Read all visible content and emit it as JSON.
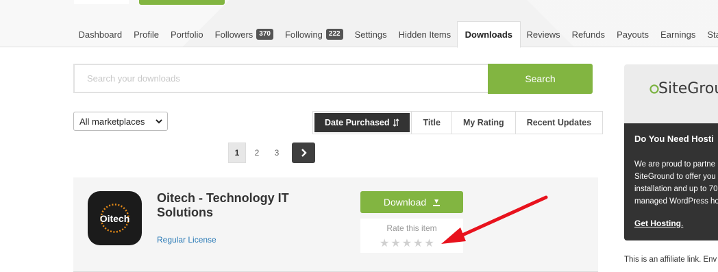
{
  "nav": {
    "tabs": [
      {
        "label": "Dashboard"
      },
      {
        "label": "Profile"
      },
      {
        "label": "Portfolio"
      },
      {
        "label": "Followers",
        "count": "370"
      },
      {
        "label": "Following",
        "count": "222"
      },
      {
        "label": "Settings"
      },
      {
        "label": "Hidden Items"
      },
      {
        "label": "Downloads",
        "active": true
      },
      {
        "label": "Reviews"
      },
      {
        "label": "Refunds"
      },
      {
        "label": "Payouts"
      },
      {
        "label": "Earnings"
      },
      {
        "label": "Statements"
      }
    ]
  },
  "search": {
    "placeholder": "Search your downloads",
    "value": "",
    "button_label": "Search"
  },
  "filters": {
    "marketplace_selected": "All marketplaces",
    "sort_options": [
      "Date Purchased",
      "Title",
      "My Rating",
      "Recent Updates"
    ],
    "active_sort": "Date Purchased",
    "sort_icon": "sort-arrows-icon"
  },
  "pagination": {
    "pages": [
      "1",
      "2",
      "3"
    ],
    "current": "1",
    "next_icon": "chevron-right-icon"
  },
  "item": {
    "logo_text": "Oitech",
    "title": "Oitech - Technology IT Solutions",
    "license": "Regular License",
    "download_label": "Download",
    "download_icon": "caret-down-icon",
    "rate_label": "Rate this item",
    "rating": 0,
    "max_rating": 5
  },
  "sidebar_ad": {
    "brand": "SiteGrou",
    "heading": "Do You Need Hosti",
    "lines": [
      "We are proud to partne",
      "SiteGround to offer you",
      "installation and up to 70",
      "managed WordPress ho"
    ],
    "link": "Get Hosting",
    "link_suffix": ".",
    "note": "This is an affiliate link. Env"
  },
  "colors": {
    "accent_green": "#82b541",
    "dark": "#333333",
    "link_blue": "#2a7ab6",
    "annotation_red": "#e8121d"
  }
}
